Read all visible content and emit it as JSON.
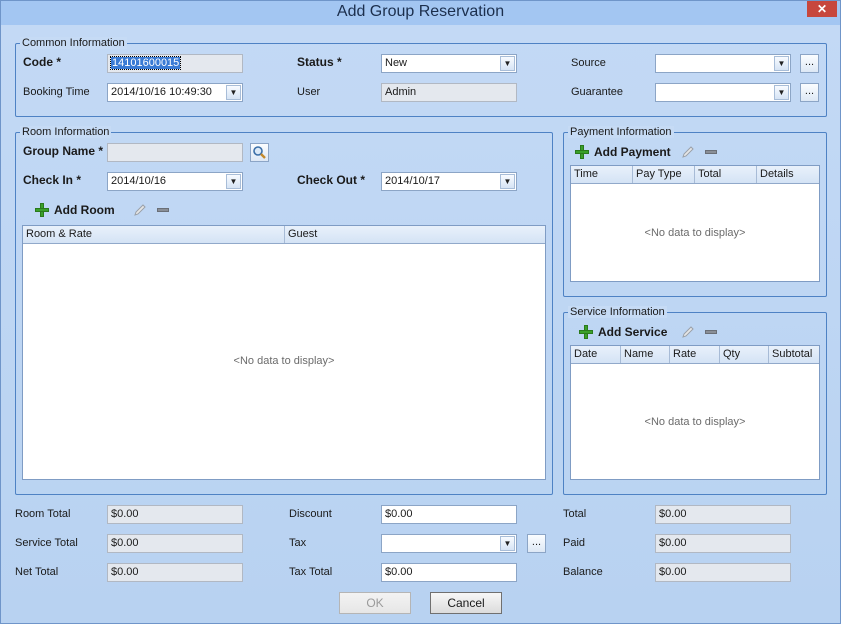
{
  "window": {
    "title": "Add Group Reservation",
    "close_glyph": "✕"
  },
  "common": {
    "legend": "Common Information",
    "code_label": "Code *",
    "code_value": "14101600015",
    "booking_time_label": "Booking Time",
    "booking_time_value": "2014/10/16 10:49:30",
    "status_label": "Status *",
    "status_value": "New",
    "user_label": "User",
    "user_value": "Admin",
    "source_label": "Source",
    "source_value": "",
    "guarantee_label": "Guarantee",
    "guarantee_value": ""
  },
  "room": {
    "legend": "Room Information",
    "group_name_label": "Group Name *",
    "group_name_value": "",
    "check_in_label": "Check In *",
    "check_in_value": "2014/10/16",
    "check_out_label": "Check Out *",
    "check_out_value": "2014/10/17",
    "add_label": "Add Room",
    "columns": [
      "Room & Rate",
      "Guest"
    ],
    "empty_text": "<No data to display>"
  },
  "payment": {
    "legend": "Payment Information",
    "add_label": "Add Payment",
    "columns": [
      "Time",
      "Pay Type",
      "Total",
      "Details"
    ],
    "empty_text": "<No data to display>"
  },
  "service": {
    "legend": "Service Information",
    "add_label": "Add Service",
    "columns": [
      "Date",
      "Name",
      "Rate",
      "Qty",
      "Subtotal"
    ],
    "empty_text": "<No data to display>"
  },
  "totals": {
    "room_total_label": "Room Total",
    "room_total_value": "$0.00",
    "service_total_label": "Service Total",
    "service_total_value": "$0.00",
    "net_total_label": "Net Total",
    "net_total_value": "$0.00",
    "discount_label": "Discount",
    "discount_value": "$0.00",
    "tax_label": "Tax",
    "tax_value": "",
    "tax_total_label": "Tax Total",
    "tax_total_value": "$0.00",
    "total_label": "Total",
    "total_value": "$0.00",
    "paid_label": "Paid",
    "paid_value": "$0.00",
    "balance_label": "Balance",
    "balance_value": "$0.00"
  },
  "buttons": {
    "ok_label": "OK",
    "cancel_label": "Cancel",
    "ellipsis": "...",
    "dropdown_glyph": "▼"
  },
  "colors": {
    "accent": "#3a7bd5",
    "group_border": "#4e82c4",
    "add_icon": "#3aa02a"
  }
}
